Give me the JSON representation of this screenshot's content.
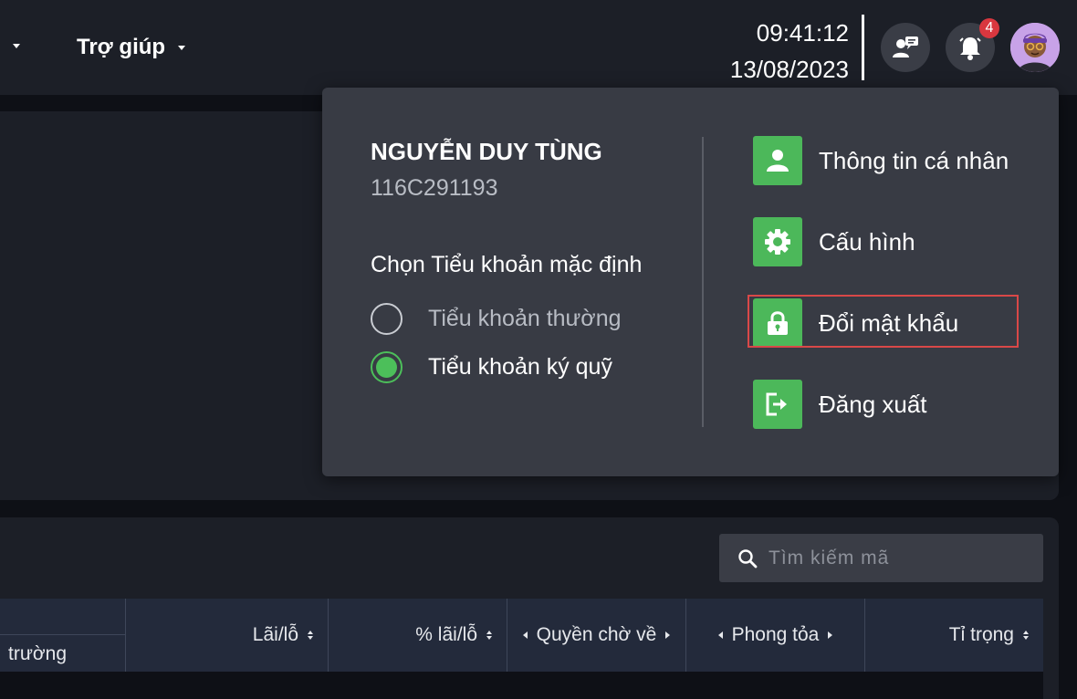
{
  "nav": {
    "help_label": "Trợ giúp"
  },
  "clock": {
    "time": "09:41:12",
    "date": "13/08/2023"
  },
  "notifications": {
    "count": "4"
  },
  "account_menu": {
    "user_name": "NGUYỄN DUY TÙNG",
    "account_id": "116C291193",
    "default_subaccount_label": "Chọn Tiểu khoản mặc định",
    "subaccount_options": [
      {
        "label": "Tiểu khoản thường",
        "selected": false
      },
      {
        "label": "Tiểu khoản ký quỹ",
        "selected": true
      }
    ],
    "items": [
      {
        "label": "Thông tin cá nhân",
        "icon": "user-icon"
      },
      {
        "label": "Cấu hình",
        "icon": "gear-icon"
      },
      {
        "label": "Đổi mật khẩu",
        "icon": "lock-icon",
        "highlighted": true
      },
      {
        "label": "Đăng xuất",
        "icon": "logout-icon"
      }
    ],
    "accent_color": "#4cb85a",
    "highlight_color": "#d94848"
  },
  "search": {
    "placeholder": "Tìm kiếm mã"
  },
  "table": {
    "first_header_partial": "trường",
    "headers": [
      "Lãi/lỗ",
      "% lãi/lỗ",
      "Quyền chờ về",
      "Phong tỏa",
      "Tỉ trọng"
    ]
  }
}
